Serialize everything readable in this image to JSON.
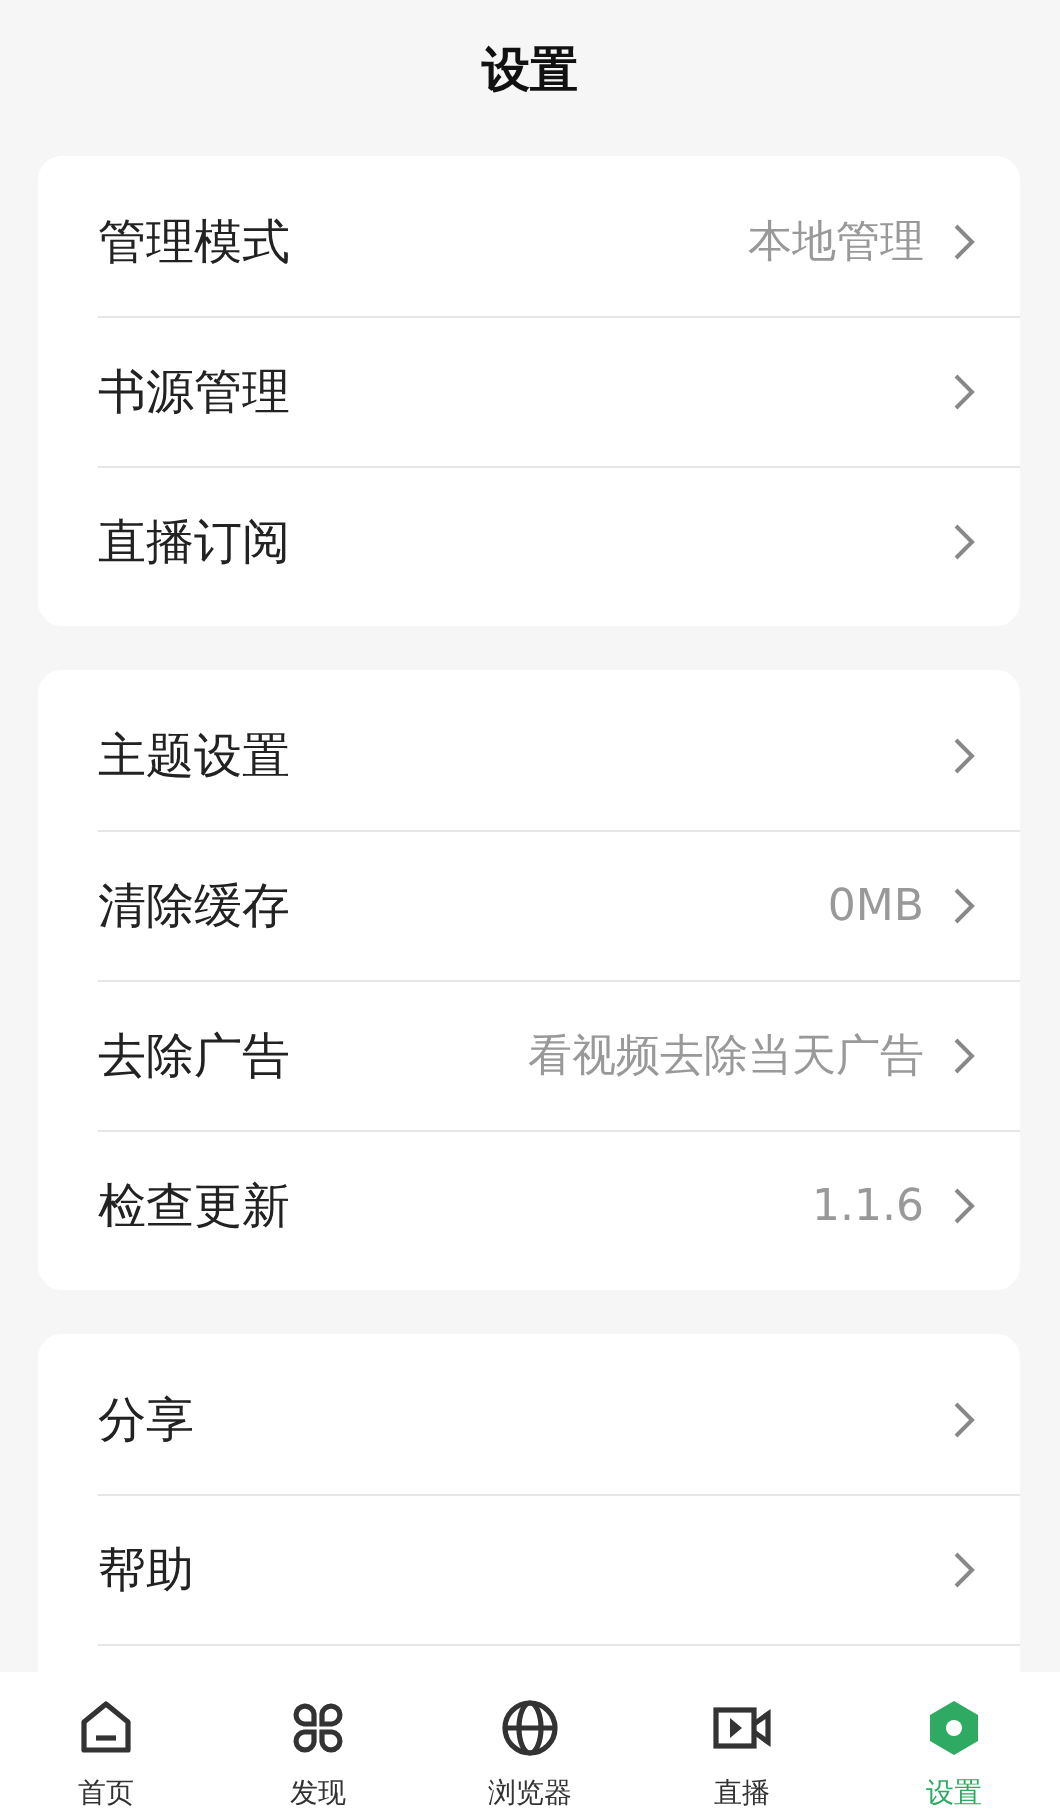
{
  "title": "设置",
  "groups": [
    {
      "continues": false,
      "items": [
        {
          "label": "管理模式",
          "value": "本地管理"
        },
        {
          "label": "书源管理"
        },
        {
          "label": "直播订阅"
        }
      ]
    },
    {
      "continues": false,
      "items": [
        {
          "label": "主题设置"
        },
        {
          "label": "清除缓存",
          "value": "0MB"
        },
        {
          "label": "去除广告",
          "value": "看视频去除当天广告"
        },
        {
          "label": "检查更新",
          "value": "1.1.6"
        }
      ]
    },
    {
      "continues": true,
      "items": [
        {
          "label": "分享"
        },
        {
          "label": "帮助"
        }
      ]
    }
  ],
  "nav": [
    {
      "kind": "home",
      "label": "首页",
      "selected": false
    },
    {
      "kind": "discover",
      "label": "发现",
      "selected": false
    },
    {
      "kind": "browser",
      "label": "浏览器",
      "selected": false
    },
    {
      "kind": "live",
      "label": "直播",
      "selected": false
    },
    {
      "kind": "settings",
      "label": "设置",
      "selected": true
    }
  ]
}
